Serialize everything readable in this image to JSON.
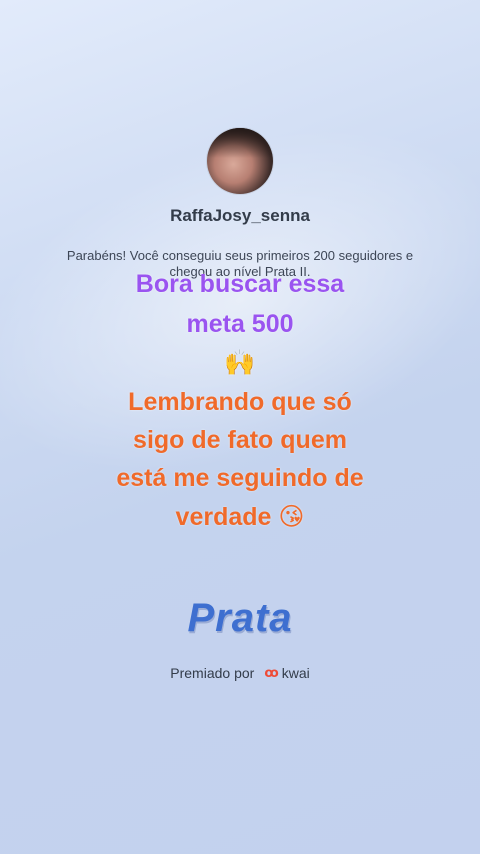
{
  "profile": {
    "username": "RaffaJosy_senna"
  },
  "card": {
    "message": "Parabéns! Você conseguiu seus primeiros 200 seguidores e chegou ao nível Prata II.",
    "level_title": "Prata",
    "awarded_by_label": "Premiado por",
    "brand_name": "kwai"
  },
  "caption": {
    "line1": "Bora buscar essa",
    "line2": "meta 500",
    "emoji1": "🙌",
    "line3": "Lembrando que só",
    "line4": "sigo de fato quem",
    "line5": "está me seguindo de",
    "line6": "verdade 😘"
  },
  "colors": {
    "caption_purple": "#9a54f0",
    "caption_orange": "#f06a2a",
    "level_blue": "#3e6fd0",
    "brand_red": "#ee4b36"
  },
  "icons": {
    "brand": "kwai-logo-icon"
  }
}
